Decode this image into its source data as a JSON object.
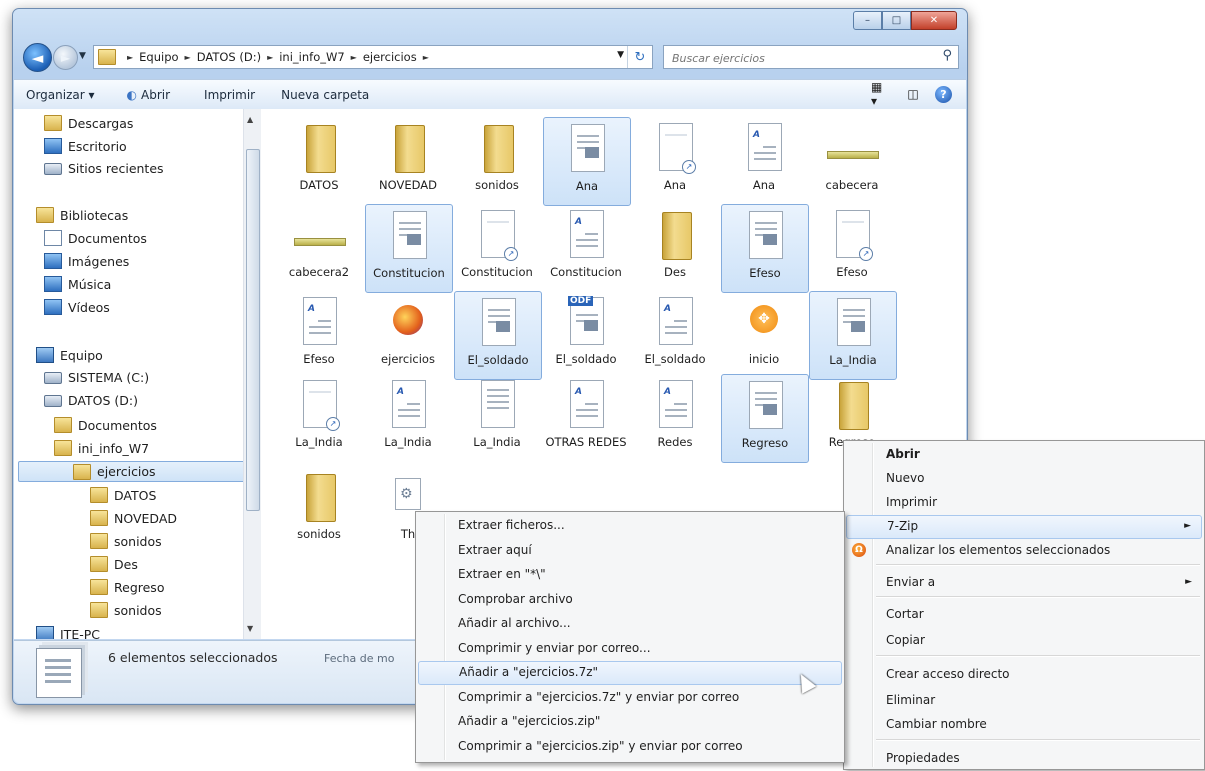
{
  "window": {
    "buttons": {
      "minimize": "–",
      "maximize": "□",
      "close": "✕"
    }
  },
  "navigation": {
    "back_glyph": "◄",
    "forward_glyph": "►",
    "breadcrumb": [
      "Equipo",
      "DATOS (D:)",
      "ini_info_W7",
      "ejercicios"
    ],
    "search_placeholder": "Buscar ejercicios"
  },
  "toolbar": {
    "organizar": "Organizar ▾",
    "abrir": "Abrir",
    "imprimir": "Imprimir",
    "nueva_carpeta": "Nueva carpeta"
  },
  "sidebar": {
    "items": [
      {
        "label": "Descargas",
        "icon": "download-folder-icon"
      },
      {
        "label": "Escritorio",
        "icon": "desktop-icon"
      },
      {
        "label": "Sitios recientes",
        "icon": "recent-places-icon"
      },
      {
        "label": "Bibliotecas",
        "icon": "libraries-icon"
      },
      {
        "label": "Documentos",
        "icon": "documents-icon"
      },
      {
        "label": "Imágenes",
        "icon": "pictures-icon"
      },
      {
        "label": "Música",
        "icon": "music-icon"
      },
      {
        "label": "Vídeos",
        "icon": "videos-icon"
      },
      {
        "label": "Equipo",
        "icon": "computer-icon"
      },
      {
        "label": "SISTEMA (C:)",
        "icon": "drive-icon"
      },
      {
        "label": "DATOS (D:)",
        "icon": "drive-icon"
      },
      {
        "label": "Documentos",
        "icon": "folder-icon"
      },
      {
        "label": "ini_info_W7",
        "icon": "folder-icon"
      },
      {
        "label": "ejercicios",
        "icon": "folder-icon"
      },
      {
        "label": "DATOS",
        "icon": "folder-icon"
      },
      {
        "label": "NOVEDAD",
        "icon": "folder-icon"
      },
      {
        "label": "sonidos",
        "icon": "folder-icon"
      },
      {
        "label": "Des",
        "icon": "folder-icon"
      },
      {
        "label": "Regreso",
        "icon": "folder-icon"
      },
      {
        "label": "sonidos",
        "icon": "folder-icon"
      },
      {
        "label": "ITE-PC",
        "icon": "network-computer-icon"
      }
    ]
  },
  "files": [
    {
      "label": "DATOS",
      "type": "folder",
      "selected": false
    },
    {
      "label": "NOVEDAD",
      "type": "folder",
      "selected": false
    },
    {
      "label": "sonidos",
      "type": "folder",
      "selected": false
    },
    {
      "label": "Ana",
      "type": "doc",
      "selected": true
    },
    {
      "label": "Ana",
      "type": "shortcut",
      "selected": false
    },
    {
      "label": "Ana",
      "type": "wordpad",
      "selected": false
    },
    {
      "label": "cabecera",
      "type": "bar",
      "selected": false
    },
    {
      "label": "cabecera2",
      "type": "bar",
      "selected": false
    },
    {
      "label": "Constitucion",
      "type": "doc",
      "selected": true
    },
    {
      "label": "Constitucion",
      "type": "shortcut",
      "selected": false
    },
    {
      "label": "Constitucion",
      "type": "wordpad",
      "selected": false
    },
    {
      "label": "Des",
      "type": "folder",
      "selected": false
    },
    {
      "label": "Efeso",
      "type": "doc",
      "selected": true
    },
    {
      "label": "Efeso",
      "type": "shortcut",
      "selected": false
    },
    {
      "label": "Efeso",
      "type": "wordpad",
      "selected": false
    },
    {
      "label": "ejercicios",
      "type": "firefox",
      "selected": false
    },
    {
      "label": "El_soldado",
      "type": "doc",
      "selected": true
    },
    {
      "label": "El_soldado",
      "type": "odf",
      "selected": false
    },
    {
      "label": "El_soldado",
      "type": "wordpad",
      "selected": false
    },
    {
      "label": "inicio",
      "type": "inicio",
      "selected": false
    },
    {
      "label": "La_India",
      "type": "doc",
      "selected": true
    },
    {
      "label": "La_India",
      "type": "shortcut",
      "selected": false
    },
    {
      "label": "La_India",
      "type": "wordpad",
      "selected": false
    },
    {
      "label": "La_India",
      "type": "text",
      "selected": false
    },
    {
      "label": "OTRAS REDES",
      "type": "wordpad",
      "selected": false
    },
    {
      "label": "Redes",
      "type": "wordpad",
      "selected": false
    },
    {
      "label": "Regreso",
      "type": "doc",
      "selected": true
    },
    {
      "label": "Regreso",
      "type": "folder",
      "selected": false
    },
    {
      "label": "sonidos",
      "type": "folder",
      "selected": false
    },
    {
      "label": "Th",
      "type": "gear",
      "selected": false
    }
  ],
  "status": {
    "selected_count": "6 elementos seleccionados",
    "meta": "Fecha de mo"
  },
  "context_menu": {
    "items": [
      {
        "label": "Abrir",
        "bold": true
      },
      {
        "label": "Nuevo"
      },
      {
        "label": "Imprimir"
      },
      {
        "label": "7-Zip",
        "submenu": true,
        "highlighted": true
      },
      {
        "label": "Analizar los elementos seleccionados",
        "icon": "antivirus-icon"
      },
      {
        "label": "Enviar a",
        "submenu": true
      },
      {
        "label": "Cortar"
      },
      {
        "label": "Copiar"
      },
      {
        "label": "Crear acceso directo"
      },
      {
        "label": "Eliminar"
      },
      {
        "label": "Cambiar nombre"
      },
      {
        "label": "Propiedades"
      }
    ]
  },
  "zip_menu": {
    "items": [
      {
        "label": "Extraer ficheros..."
      },
      {
        "label": "Extraer aquí"
      },
      {
        "label": "Extraer en \"*\\\""
      },
      {
        "label": "Comprobar archivo"
      },
      {
        "label": "Añadir al archivo..."
      },
      {
        "label": "Comprimir y enviar por correo..."
      },
      {
        "label": "Añadir a \"ejercicios.7z\"",
        "highlighted": true
      },
      {
        "label": "Comprimir a \"ejercicios.7z\" y enviar por correo"
      },
      {
        "label": "Añadir a \"ejercicios.zip\""
      },
      {
        "label": "Comprimir a \"ejercicios.zip\" y enviar por correo"
      }
    ]
  }
}
